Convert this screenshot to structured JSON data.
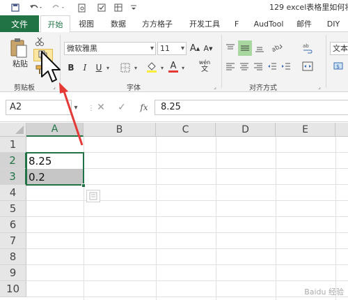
{
  "window": {
    "title": "129 excel表格里如何将"
  },
  "tabs": {
    "file": "文件",
    "home": "开始",
    "view": "视图",
    "data": "数据",
    "fangfang": "方方格子",
    "developer": "开发工具",
    "f": "F",
    "audtool": "AudTool",
    "mail": "邮件",
    "diy": "DIY"
  },
  "ribbon": {
    "paste_label": "粘贴",
    "clipboard_label": "剪贴板",
    "font_name": "微软雅黑",
    "font_size": "11",
    "font_group_label": "字体",
    "align_group_label": "对齐方式",
    "bold": "B",
    "italic": "I",
    "underline": "U",
    "wen": "wén",
    "number_format": "文本",
    "font_color_letter": "A",
    "inc_font": "A",
    "dec_font": "A"
  },
  "formula_bar": {
    "name_box": "A2",
    "fx": "fx",
    "content": "8.25"
  },
  "sheet": {
    "columns": [
      "A",
      "B",
      "C",
      "D",
      "E"
    ],
    "rows": [
      "1",
      "2",
      "3",
      "4",
      "5",
      "6",
      "7",
      "8",
      "9",
      "10"
    ],
    "cells": {
      "A2": "8.25",
      "A3": "0.2"
    }
  },
  "watermark": "Baidu 经验",
  "colors": {
    "excel_green": "#217346",
    "arrow_red": "#e53935"
  }
}
